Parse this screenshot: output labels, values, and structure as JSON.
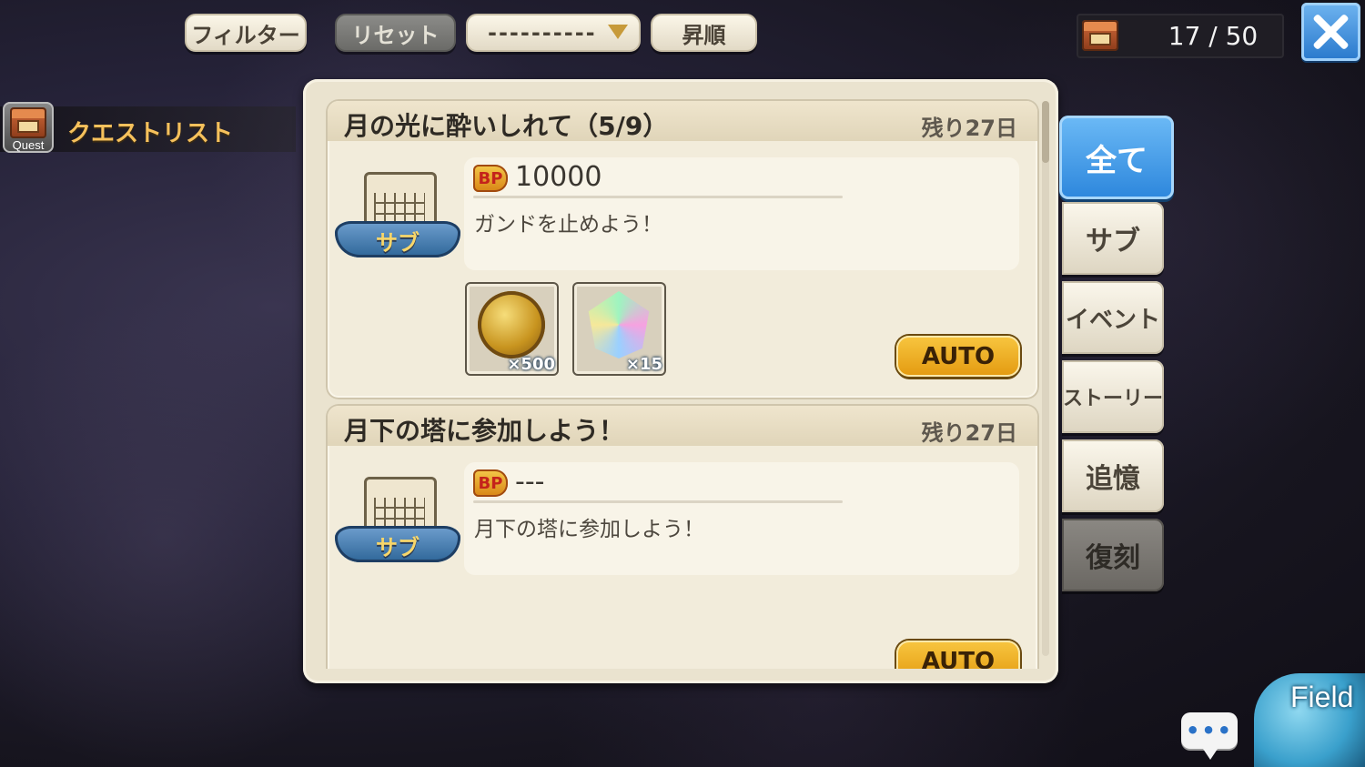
{
  "toolbar": {
    "filter_label": "フィルター",
    "reset_label": "リセット",
    "sort_select_value": "----------",
    "order_label": "昇順"
  },
  "counter": {
    "text": "17 / 50"
  },
  "sidebar": {
    "icon_caption": "Quest",
    "title": "クエストリスト"
  },
  "quests": [
    {
      "title": "月の光に酔いしれて（5/9）",
      "remaining": "残り27日",
      "category": "サブ",
      "bp_label": "BP",
      "bp_value": "10000",
      "description": "ガンドを止めよう！",
      "rewards": [
        {
          "icon": "gold-coin-icon",
          "qty": "×500"
        },
        {
          "icon": "rainbow-crystal-icon",
          "qty": "×15"
        }
      ],
      "auto_label": "AUTO"
    },
    {
      "title": "月下の塔に参加しよう！",
      "remaining": "残り27日",
      "category": "サブ",
      "bp_label": "BP",
      "bp_value": "---",
      "description": "月下の塔に参加しよう！",
      "rewards": [],
      "auto_label": "AUTO"
    }
  ],
  "tabs": [
    {
      "label": "全て",
      "state": "active"
    },
    {
      "label": "サブ",
      "state": "normal"
    },
    {
      "label": "イベント",
      "state": "normal"
    },
    {
      "label": "ストーリー",
      "state": "normal"
    },
    {
      "label": "追憶",
      "state": "normal"
    },
    {
      "label": "復刻",
      "state": "disabled"
    }
  ],
  "bottom": {
    "chat_glyph": "•••",
    "field_label": "Field"
  },
  "colors": {
    "accent_blue": "#2c86dc",
    "auto_gold": "#e39a10",
    "title_gold": "#f6c15c"
  }
}
